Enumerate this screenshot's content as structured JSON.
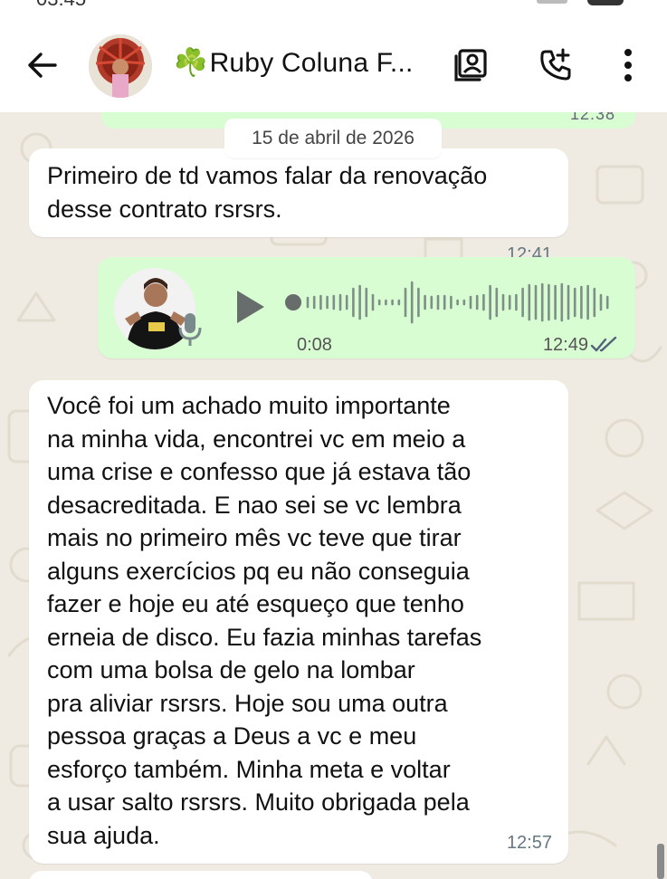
{
  "header": {
    "contact_name_emoji": "☘️",
    "contact_name": "Ruby Coluna F..."
  },
  "previous_message": {
    "time": "12:38"
  },
  "date_chip": "15 de abril de 2026",
  "messages": [
    {
      "type": "text",
      "direction": "incoming",
      "text": "Primeiro de td vamos falar da renovação\ndesse contrato rsrsrs.",
      "time": "12:41"
    },
    {
      "type": "voice",
      "direction": "outgoing",
      "duration": "0:08",
      "time": "12:49",
      "status": "read"
    },
    {
      "type": "text",
      "direction": "incoming",
      "text": "Você foi um achado muito importante\nna minha vida, encontrei vc em meio a\numa crise e confesso que já estava tão\ndesacreditada. E nao sei se vc lembra\nmais no primeiro mês vc teve que tirar\nalguns exercícios pq eu não conseguia\nfazer e hoje eu até esqueço que tenho\nerneia de disco. Eu fazia minhas tarefas\ncom uma bolsa de gelo na lombar\npra aliviar rsrsrs. Hoje sou uma outra\npessoa graças a Deus a vc e meu\nesforço também. Minha meta e voltar\na usar salto rsrsrs. Muito obrigada pela\nsua ajuda.",
      "time": "12:57"
    }
  ],
  "colors": {
    "incoming_bubble": "#ffffff",
    "outgoing_bubble": "#d9fdd3",
    "chat_background": "#efeae2",
    "read_ticks": "#53bdeb"
  },
  "icons": {
    "back": "arrow-left-icon",
    "contact_card": "contact-card-icon",
    "add_call": "add-call-icon",
    "menu": "more-vert-icon",
    "play": "play-icon",
    "mic": "mic-icon"
  }
}
